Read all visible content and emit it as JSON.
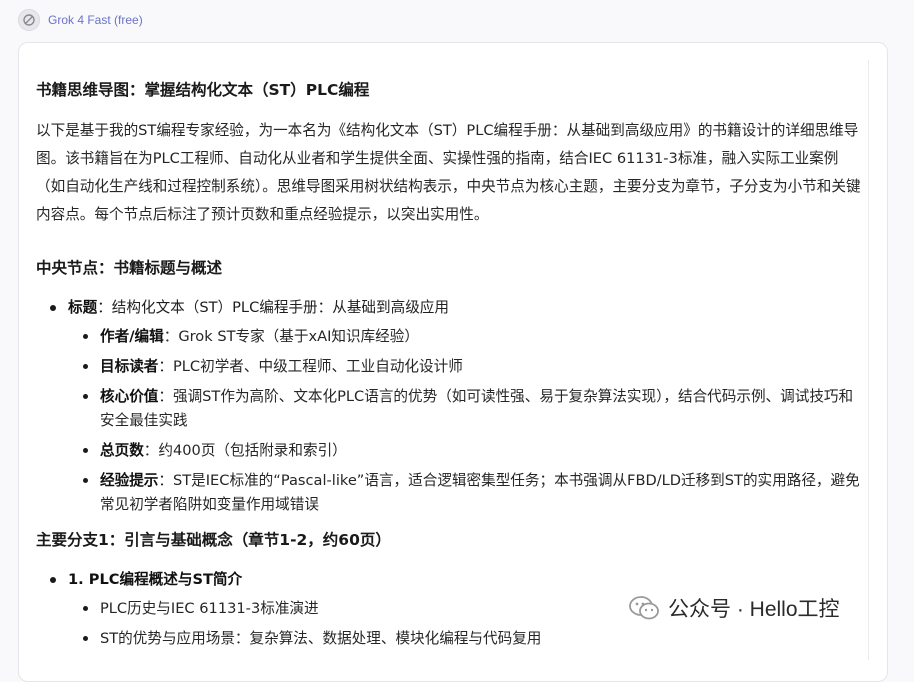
{
  "model": {
    "name": "Grok 4 Fast (free)"
  },
  "doc": {
    "title": "书籍思维导图：掌握结构化文本（ST）PLC编程",
    "intro": "以下是基于我的ST编程专家经验，为一本名为《结构化文本（ST）PLC编程手册：从基础到高级应用》的书籍设计的详细思维导图。该书籍旨在为PLC工程师、自动化从业者和学生提供全面、实操性强的指南，结合IEC 61131-3标准，融入实际工业案例（如自动化生产线和过程控制系统）。思维导图采用树状结构表示，中央节点为核心主题，主要分支为章节，子分支为小节和关键内容点。每个节点后标注了预计页数和重点经验提示，以突出实用性。",
    "central": {
      "heading": "中央节点：书籍标题与概述",
      "title_key": "标题",
      "title_value": "：结构化文本（ST）PLC编程手册：从基础到高级应用",
      "items": [
        {
          "key": "作者/编辑",
          "value": "：Grok ST专家（基于xAI知识库经验）"
        },
        {
          "key": "目标读者",
          "value": "：PLC初学者、中级工程师、工业自动化设计师"
        },
        {
          "key": "核心价值",
          "value": "：强调ST作为高阶、文本化PLC语言的优势（如可读性强、易于复杂算法实现），结合代码示例、调试技巧和安全最佳实践"
        },
        {
          "key": "总页数",
          "value": "：约400页（包括附录和索引）"
        },
        {
          "key": "经验提示",
          "value": "：ST是IEC标准的“Pascal-like”语言，适合逻辑密集型任务；本书强调从FBD/LD迁移到ST的实用路径，避免常见初学者陷阱如变量作用域错误"
        }
      ]
    },
    "branch1": {
      "heading": "主要分支1：引言与基础概念（章节1-2，约60页）",
      "chapter": "1. PLC编程概述与ST简介",
      "items": [
        {
          "text": "PLC历史与IEC 61131-3标准演进"
        },
        {
          "text": "ST的优势与应用场景：复杂算法、数据处理、模块化编程与代码复用"
        }
      ]
    }
  },
  "watermark": {
    "text": "公众号 · Hello工控"
  }
}
